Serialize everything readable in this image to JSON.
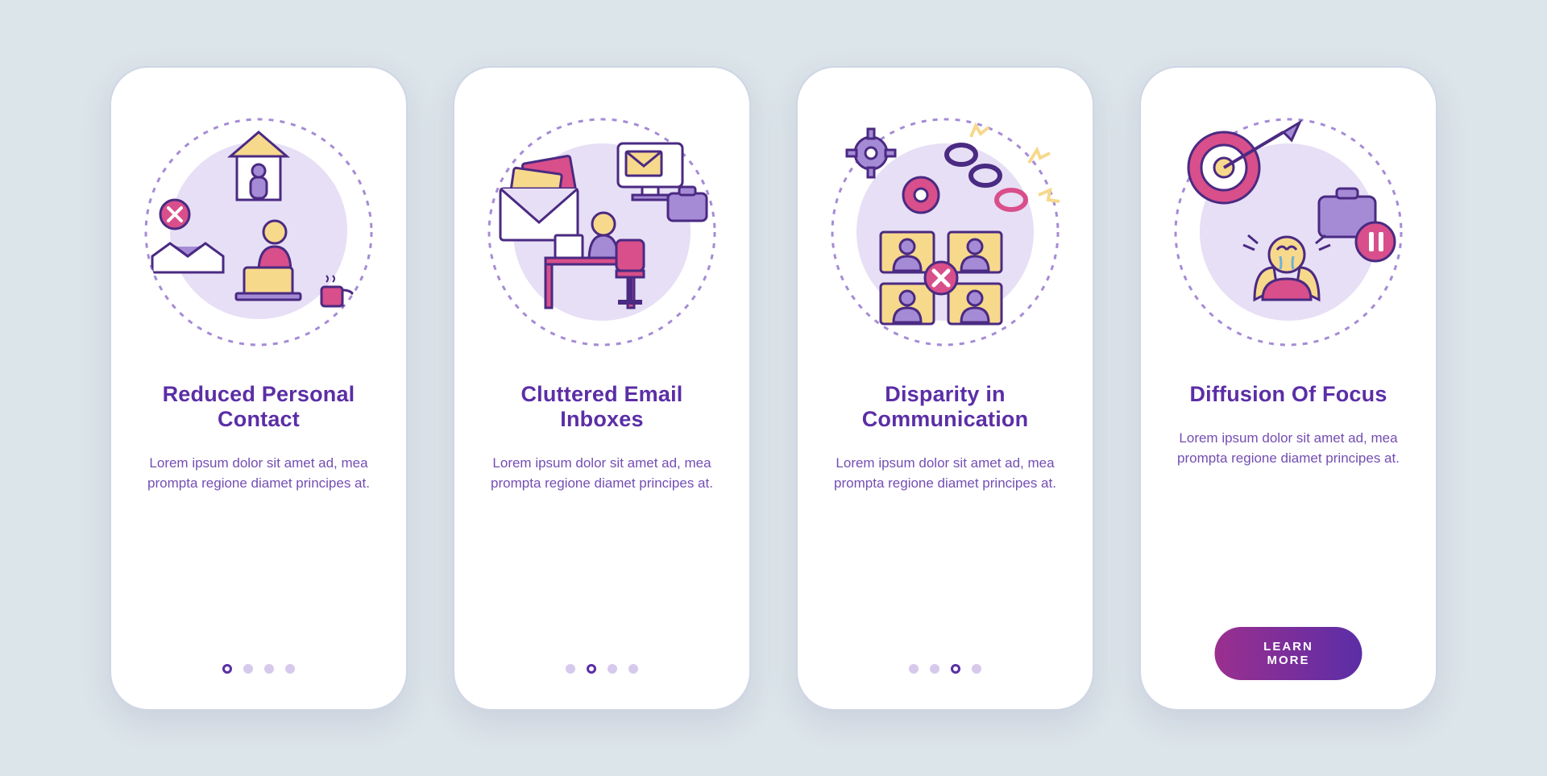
{
  "colors": {
    "background": "#dce5ea",
    "card_background": "#ffffff",
    "card_border": "#cfd6e4",
    "accent": "#5b2ea6",
    "pagination_off": "#d7c9ec",
    "pagination_on": "#5b2ea6",
    "button_gradient": [
      "#9b2f8f",
      "#5b2ea6"
    ],
    "illustration_pink": "#d84f8b",
    "illustration_lilac": "#a58bd6",
    "illustration_pale": "#e7dff5",
    "illustration_yellow": "#f7d98c",
    "illustration_line": "#4a2a82"
  },
  "cards": [
    {
      "title": "Reduced Personal Contact",
      "body": "Lorem ipsum dolor sit amet ad, mea prompta regione diamet principes at.",
      "active_page_index": 0,
      "total_pages": 4,
      "icon": "reduced-contact-icon"
    },
    {
      "title": "Cluttered Email Inboxes",
      "body": "Lorem ipsum dolor sit amet ad, mea prompta regione diamet principes at.",
      "active_page_index": 1,
      "total_pages": 4,
      "icon": "cluttered-inbox-icon"
    },
    {
      "title": "Disparity in Communication",
      "body": "Lorem ipsum dolor sit amet ad, mea prompta regione diamet principes at.",
      "active_page_index": 2,
      "total_pages": 4,
      "icon": "disparity-communication-icon"
    },
    {
      "title": "Diffusion Of Focus",
      "body": "Lorem ipsum dolor sit amet ad, mea prompta regione diamet principes at.",
      "active_page_index": null,
      "total_pages": 4,
      "cta_label": "LEARN MORE",
      "icon": "diffusion-focus-icon"
    }
  ]
}
